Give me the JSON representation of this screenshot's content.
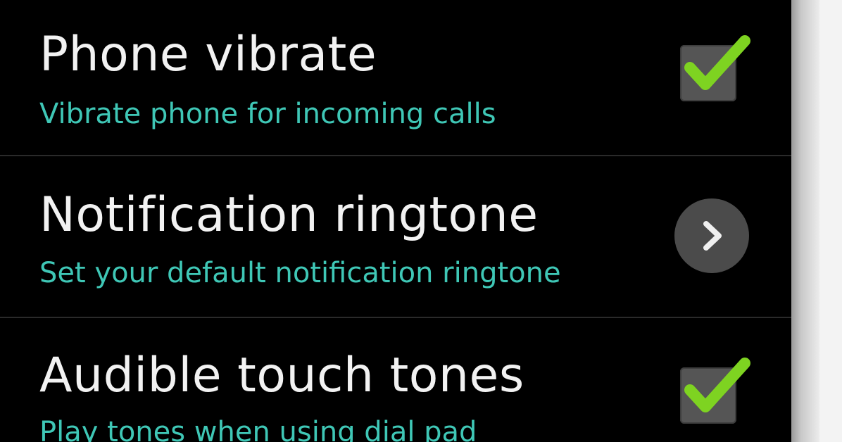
{
  "settings": {
    "items": [
      {
        "title": "Phone vibrate",
        "summary": "Vibrate phone for incoming calls",
        "control": "checkbox",
        "checked": true
      },
      {
        "title": "Notification ringtone",
        "summary": "Set your default notification ringtone",
        "control": "chevron",
        "icon": "chevron-right-icon"
      },
      {
        "title": "Audible touch tones",
        "summary": "Play tones when using dial pad",
        "control": "checkbox",
        "checked": true
      }
    ]
  },
  "colors": {
    "background": "#000000",
    "title": "#f2f2f2",
    "summary": "#3fc7b6",
    "checkmark": "#7ed321",
    "checkbox": "#555555",
    "chevron_button": "#4b4b4b"
  }
}
